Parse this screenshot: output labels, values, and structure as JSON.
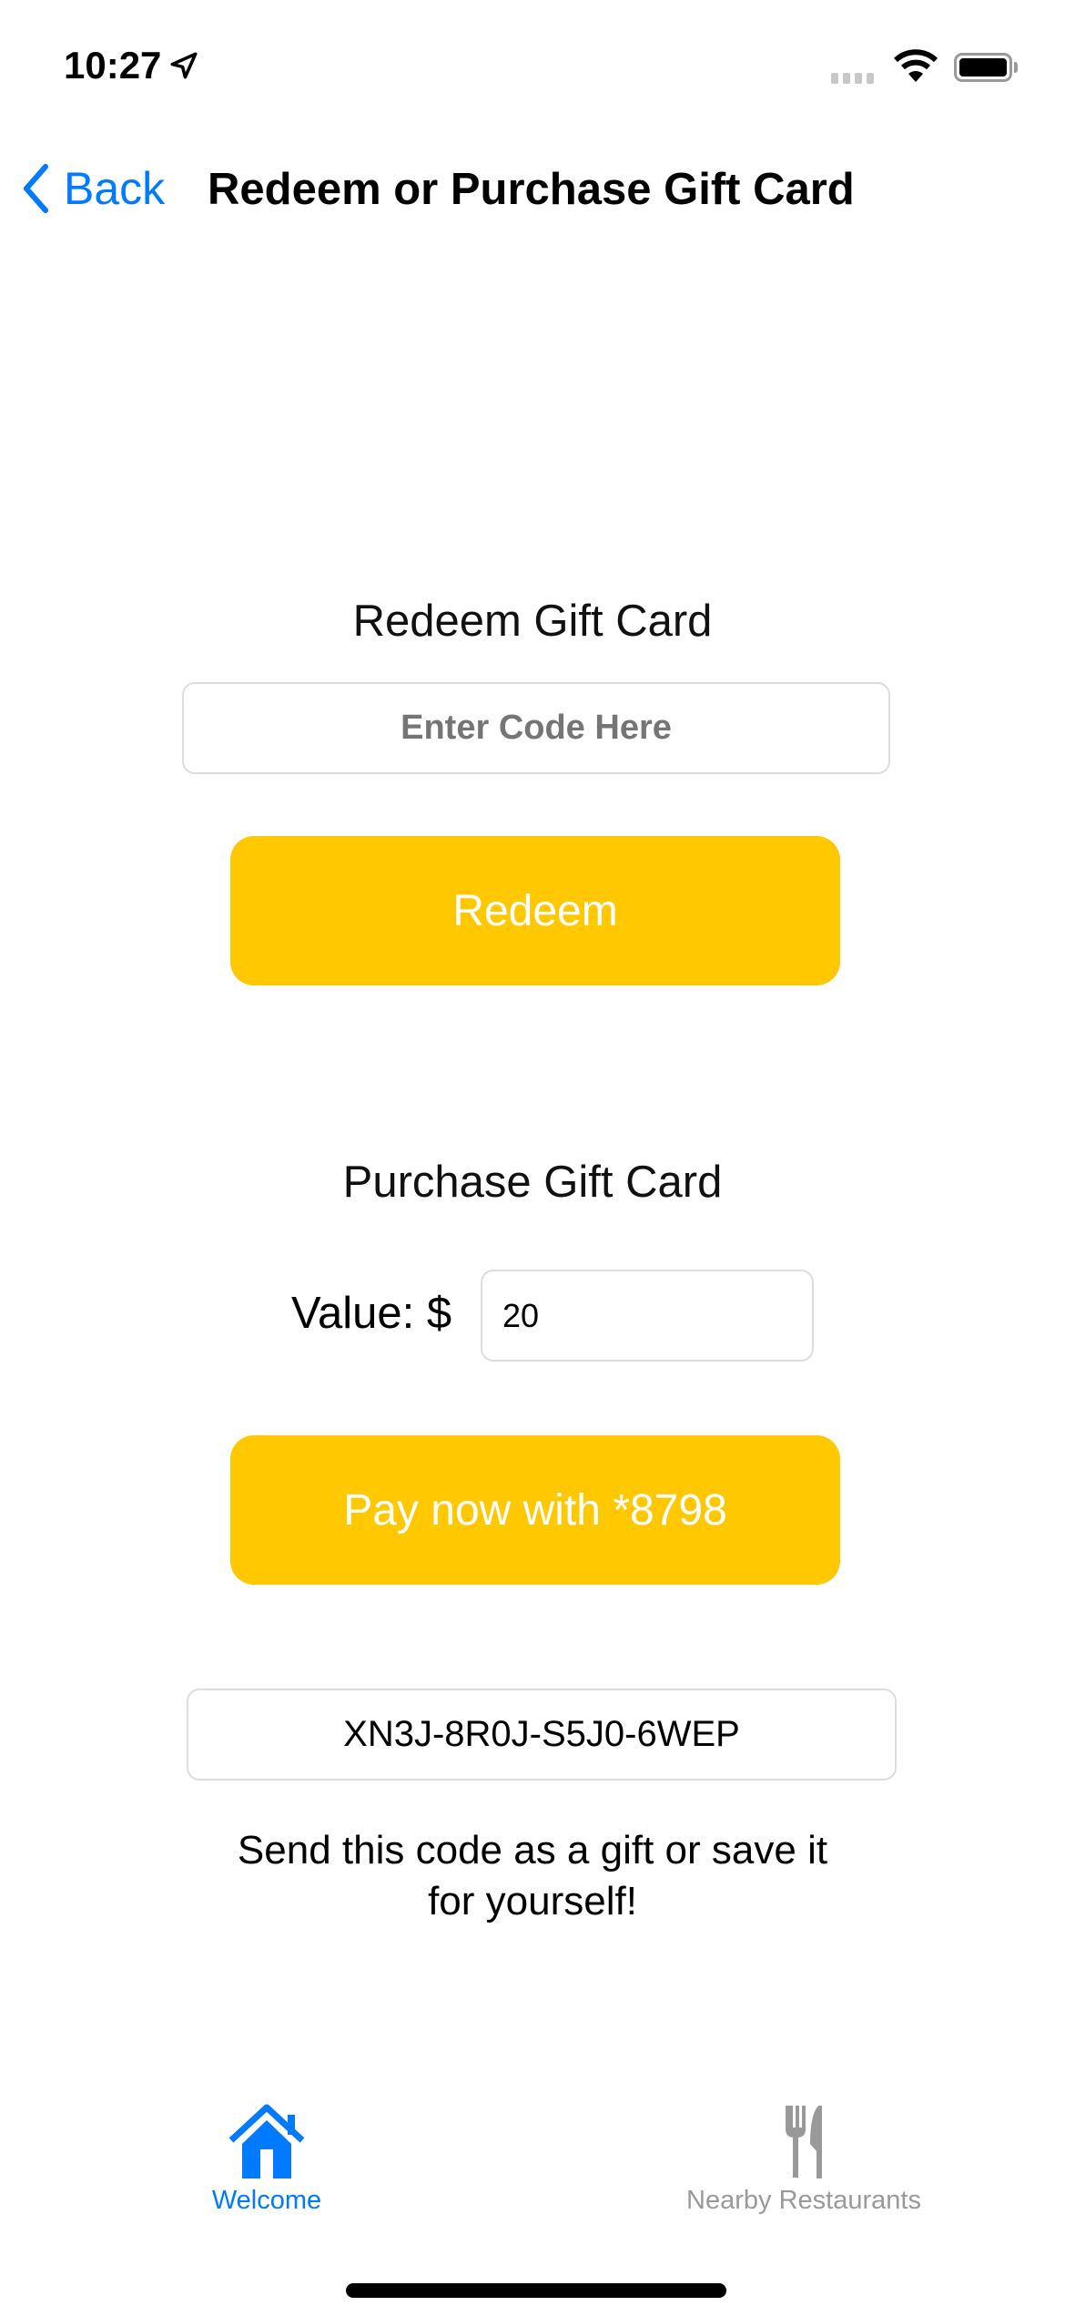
{
  "status_bar": {
    "time": "10:27"
  },
  "nav": {
    "back_label": "Back",
    "title": "Redeem or Purchase Gift Card"
  },
  "redeem": {
    "title": "Redeem Gift Card",
    "code_placeholder": "Enter Code Here",
    "code_value": "",
    "button_label": "Redeem"
  },
  "purchase": {
    "title": "Purchase Gift Card",
    "value_label": "Value: $",
    "value": "20",
    "button_label": "Pay now with *8798"
  },
  "generated_code": "XN3J-8R0J-S5J0-6WEP",
  "gift_message_line1": "Send this code as a gift or save it",
  "gift_message_line2": "for yourself!",
  "tabs": [
    {
      "label": "Welcome",
      "icon": "house-icon",
      "active": true
    },
    {
      "label": "Nearby Restaurants",
      "icon": "fork-knife-icon",
      "active": false
    }
  ],
  "colors": {
    "accent": "#007aff",
    "button": "#ffc800",
    "inactive": "#999999"
  }
}
